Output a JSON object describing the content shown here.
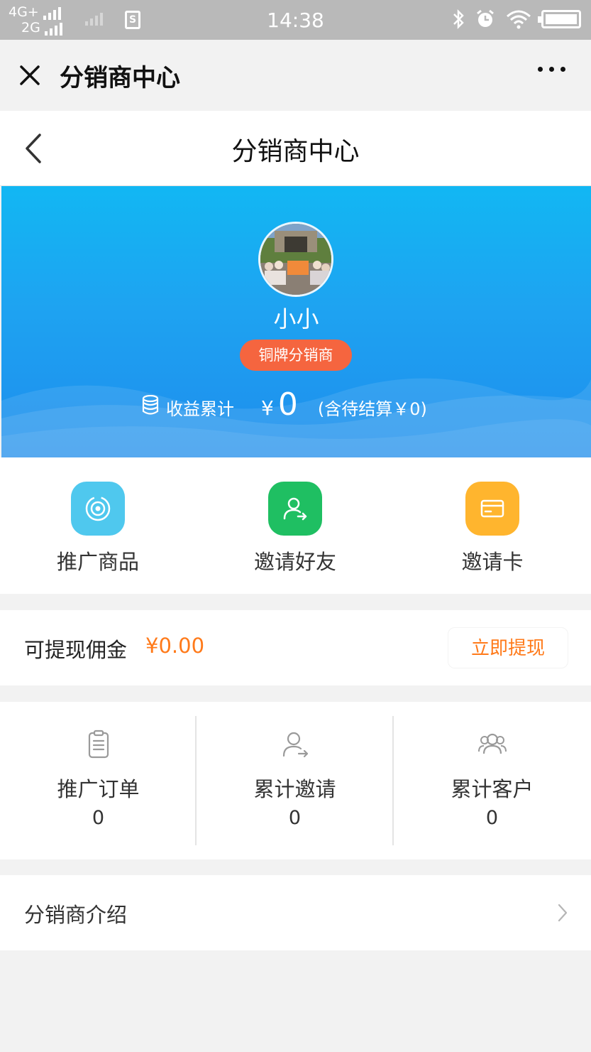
{
  "status_bar": {
    "network_top": "4G+",
    "network_bottom": "2G",
    "sim_label": "S",
    "time": "14:38"
  },
  "wechat_bar": {
    "title": "分销商中心"
  },
  "nav": {
    "title": "分销商中心"
  },
  "profile": {
    "name": "小小",
    "level_badge": "铜牌分销商",
    "earnings_label": "收益累计",
    "currency_symbol": "¥",
    "earnings_total": "0",
    "earnings_pending": "(含待结算￥0)"
  },
  "actions": [
    {
      "label": "推广商品",
      "icon": "target-icon",
      "color": "#4fc8ee"
    },
    {
      "label": "邀请好友",
      "icon": "invite-user-icon",
      "color": "#1fbf62"
    },
    {
      "label": "邀请卡",
      "icon": "card-icon",
      "color": "#ffb52e"
    }
  ],
  "withdraw": {
    "label": "可提现佣金",
    "amount": "¥0.00",
    "button_label": "立即提现"
  },
  "stats": [
    {
      "label": "推广订单",
      "value": "0",
      "icon": "clipboard-icon"
    },
    {
      "label": "累计邀请",
      "value": "0",
      "icon": "invite-user-icon"
    },
    {
      "label": "累计客户",
      "value": "0",
      "icon": "group-icon"
    }
  ],
  "intro": {
    "label": "分销商介绍"
  },
  "colors": {
    "hero_top": "#12b7f3",
    "hero_bottom": "#1e8ded",
    "badge": "#f5653f",
    "accent_orange": "#ff7a1a"
  }
}
